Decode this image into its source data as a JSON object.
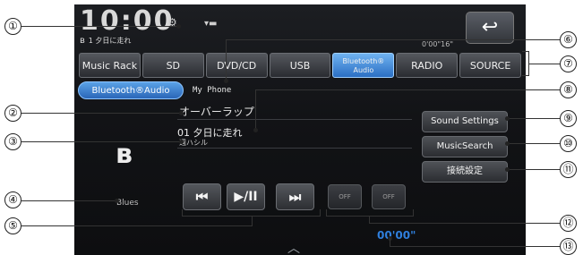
{
  "status": {
    "clock": "10:00",
    "bt_symbol": "ʙ",
    "track_line": "1 夕日に走れ",
    "elapsed_top": "0'00\"16\""
  },
  "back_icon": "↩",
  "tabs": [
    {
      "label": "Music Rack",
      "active": false
    },
    {
      "label": "SD",
      "active": false
    },
    {
      "label": "DVD/CD",
      "active": false
    },
    {
      "label": "USB",
      "active": false
    },
    {
      "label": "Bluetooth® Audio",
      "active": true
    },
    {
      "label": "RADIO",
      "active": false
    },
    {
      "label": "SOURCE",
      "active": false
    }
  ],
  "source": {
    "label": "Bluetooth®Audio",
    "device": "My Phone"
  },
  "now_playing": {
    "album": "オーバーラップ",
    "track": "01 夕日に走れ",
    "artist": "週ハシル",
    "genre": "Blues"
  },
  "side_buttons": {
    "sound": "Sound Settings",
    "music_search": "MusicSearch",
    "connect": "接続設定"
  },
  "controls": {
    "prev": "⏮",
    "play_pause": "▶/II",
    "next": "⏭",
    "shuffle": "OFF",
    "repeat": "OFF"
  },
  "playtime": "00'00\"",
  "chevron": "︿",
  "callouts": [
    "①",
    "②",
    "③",
    "④",
    "⑤",
    "⑥",
    "⑦",
    "⑧",
    "⑨",
    "⑩",
    "⑪",
    "⑫",
    "⑬"
  ]
}
